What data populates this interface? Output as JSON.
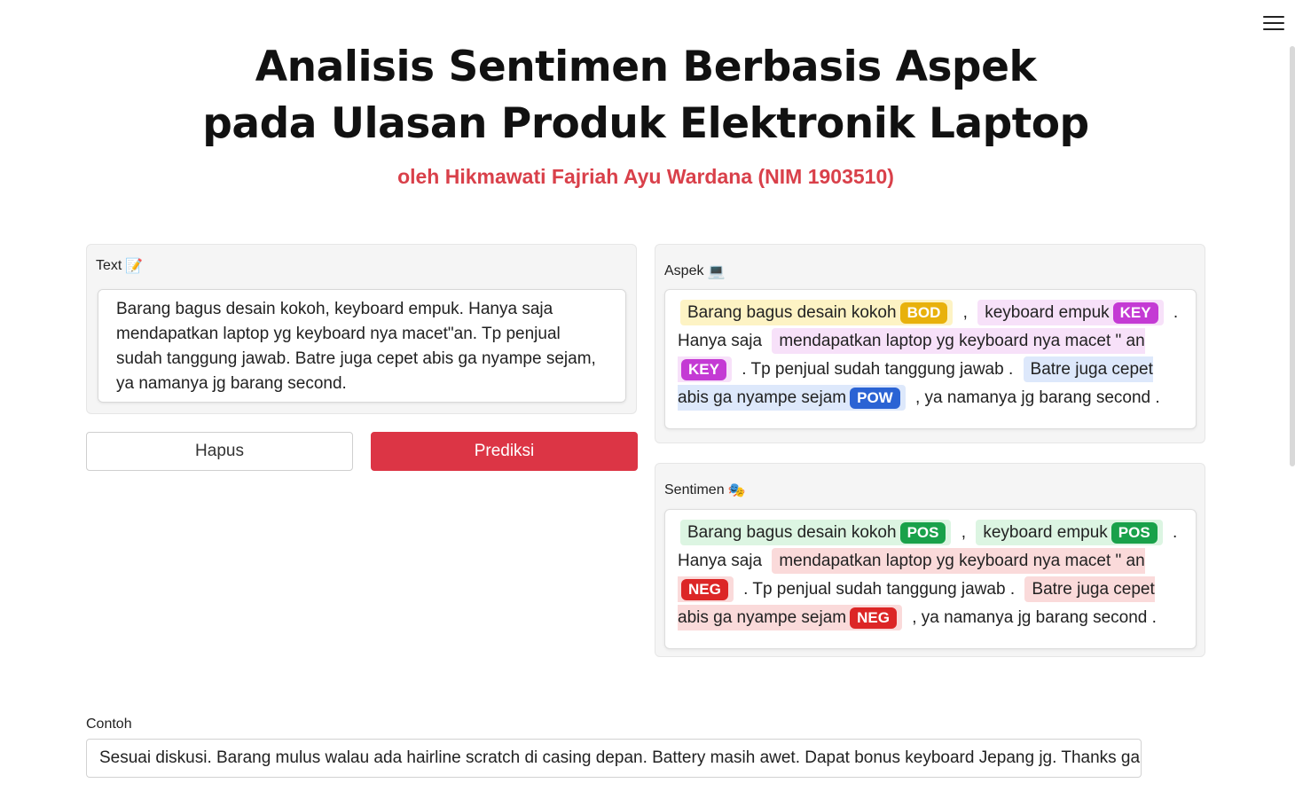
{
  "header": {
    "title_line1": "Analisis Sentimen Berbasis Aspek",
    "title_line2": "pada Ulasan Produk Elektronik Laptop",
    "subtitle": "oleh Hikmawati Fajriah Ayu Wardana (NIM 1903510)"
  },
  "input_panel": {
    "label": "Text",
    "label_icon": "📝",
    "text": "Barang bagus desain kokoh, keyboard empuk. Hanya saja mendapatkan laptop yg keyboard nya macet\"an. Tp penjual sudah tanggung jawab. Batre juga cepet abis ga nyampe sejam, ya namanya jg barang second."
  },
  "buttons": {
    "hapus": "Hapus",
    "prediksi": "Prediksi"
  },
  "aspek": {
    "label": "Aspek",
    "label_icon": "💻",
    "segments": [
      {
        "text": "Barang bagus desain kokoh",
        "tag": "BOD",
        "bg": "#fdf3c4",
        "tagbg": "#e8b10c"
      },
      {
        "text": ","
      },
      {
        "text": "keyboard empuk",
        "tag": "KEY",
        "bg": "#f7e1f9",
        "tagbg": "#c43ad4"
      },
      {
        "text": ". Hanya saja"
      },
      {
        "text": "mendapatkan laptop yg keyboard nya macet \" an",
        "tag": "KEY",
        "bg": "#f7e1f9",
        "tagbg": "#c43ad4"
      },
      {
        "text": ". Tp penjual sudah tanggung jawab ."
      },
      {
        "text": "Batre juga cepet abis ga nyampe sejam",
        "tag": "POW",
        "bg": "#dde8fb",
        "tagbg": "#2a63d4"
      },
      {
        "text": ", ya namanya jg barang second ."
      }
    ]
  },
  "sentimen": {
    "label": "Sentimen",
    "label_icon": "🎭",
    "segments": [
      {
        "text": "Barang bagus desain kokoh",
        "tag": "POS",
        "bg": "#dcf5e2",
        "tagbg": "#19a14a"
      },
      {
        "text": ","
      },
      {
        "text": "keyboard empuk",
        "tag": "POS",
        "bg": "#dcf5e2",
        "tagbg": "#19a14a"
      },
      {
        "text": ". Hanya saja"
      },
      {
        "text": "mendapatkan laptop yg keyboard nya macet \" an",
        "tag": "NEG",
        "bg": "#fadada",
        "tagbg": "#dc2626"
      },
      {
        "text": ". Tp penjual sudah tanggung jawab ."
      },
      {
        "text": "Batre juga cepet abis ga nyampe sejam",
        "tag": "NEG",
        "bg": "#fadada",
        "tagbg": "#dc2626"
      },
      {
        "text": ", ya namanya jg barang second ."
      }
    ]
  },
  "contoh": {
    "label": "Contoh",
    "value": "Sesuai diskusi. Barang mulus walau ada hairline scratch di casing depan. Battery masih awet. Dapat bonus keyboard Jepang jg. Thanks gan."
  }
}
